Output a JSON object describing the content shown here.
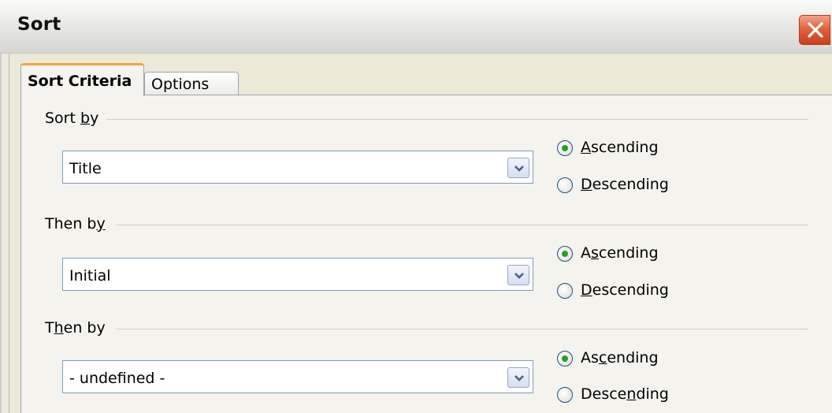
{
  "window": {
    "title": "Sort"
  },
  "tabs": [
    {
      "label": "Sort Criteria",
      "active": true
    },
    {
      "label": "Options",
      "active": false
    }
  ],
  "criteria": [
    {
      "group_label_parts": [
        "Sort ",
        "b",
        "y"
      ],
      "field_value": "Title",
      "ascending_parts": [
        "",
        "A",
        "scending"
      ],
      "descending_parts": [
        "",
        "D",
        "escending"
      ],
      "selected": "ascending"
    },
    {
      "group_label_parts": [
        "Then b",
        "y",
        ""
      ],
      "field_value": "Initial",
      "ascending_parts": [
        "A",
        "s",
        "cending"
      ],
      "descending_parts": [
        "",
        "D",
        "escending"
      ],
      "selected": "ascending"
    },
    {
      "group_label_parts": [
        "T",
        "h",
        "en by"
      ],
      "field_value": "- undefined -",
      "ascending_parts": [
        "As",
        "c",
        "ending"
      ],
      "descending_parts": [
        "Desce",
        "n",
        "ding"
      ],
      "selected": "ascending"
    }
  ],
  "colors": {
    "accent_tab": "#f0a53c",
    "radio_dot": "#21a121",
    "close_button": "#e4623f"
  },
  "icons": [
    "close-icon",
    "chevron-down-icon"
  ]
}
